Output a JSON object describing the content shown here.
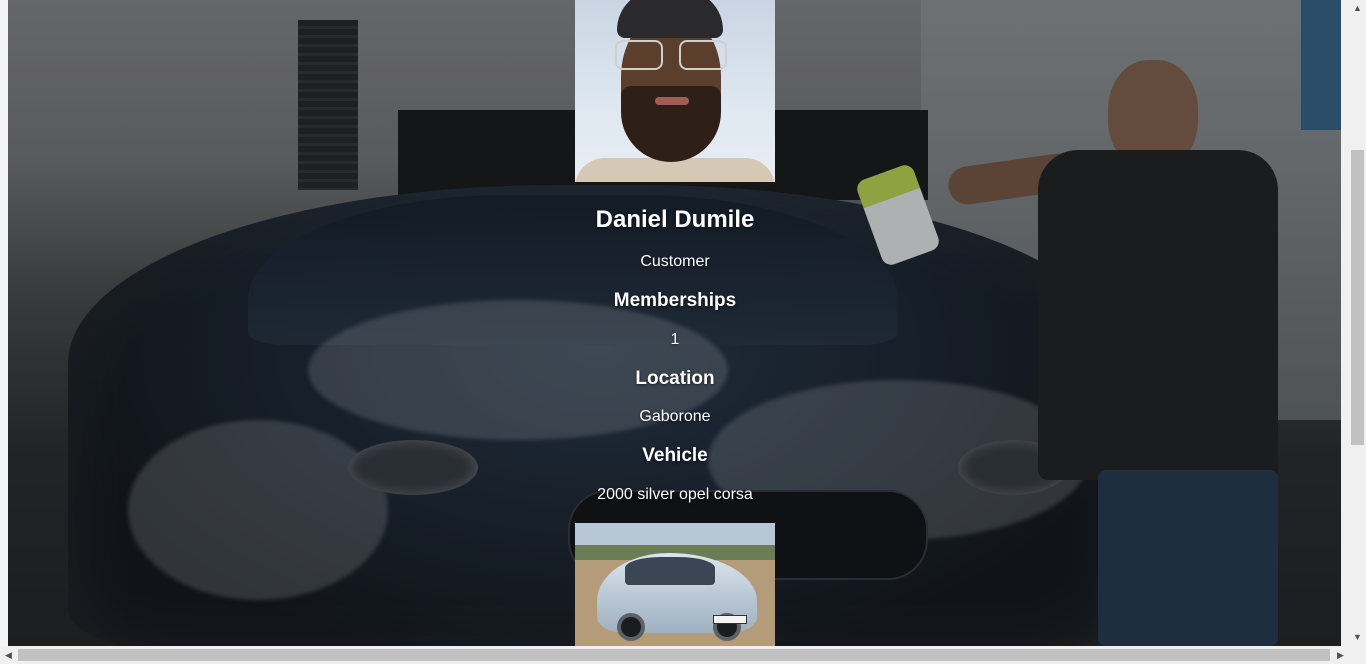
{
  "profile": {
    "name": "Daniel Dumile",
    "role": "Customer",
    "memberships_heading": "Memberships",
    "memberships_value": "1",
    "location_heading": "Location",
    "location_value": "Gaborone",
    "vehicle_heading": "Vehicle",
    "vehicle_value": "2000 silver opel corsa"
  },
  "icons": {
    "scroll_up": "▲",
    "scroll_down": "▼",
    "scroll_left": "◀",
    "scroll_right": "▶"
  },
  "colors": {
    "text": "#ffffff",
    "scrollbar_track": "#f0f0f0",
    "scrollbar_thumb": "#c1c1c1"
  }
}
